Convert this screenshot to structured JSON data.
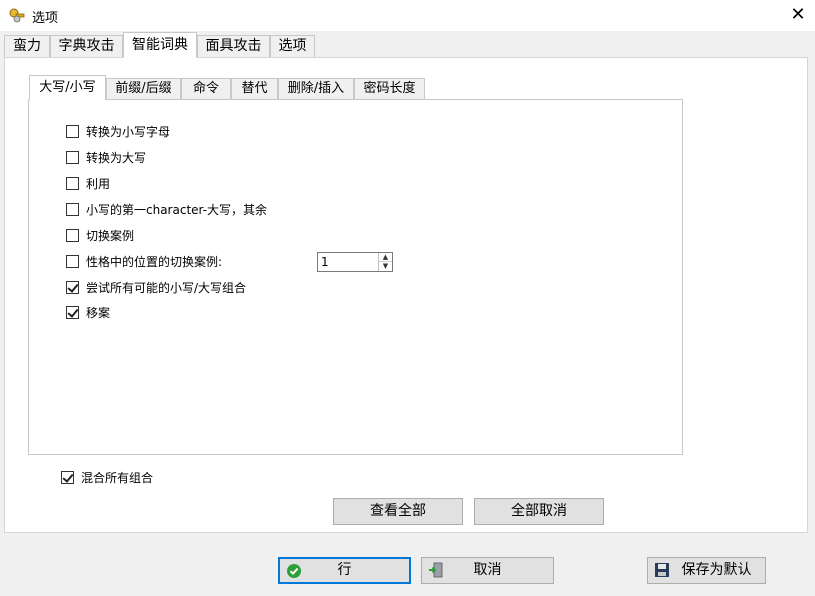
{
  "window": {
    "title": "选项"
  },
  "main_tabs": [
    {
      "label": "蛮力"
    },
    {
      "label": "字典攻击"
    },
    {
      "label": "智能词典"
    },
    {
      "label": "面具攻击"
    },
    {
      "label": "选项"
    }
  ],
  "sub_tabs": [
    {
      "label": "大写/小写"
    },
    {
      "label": "前缀/后缀"
    },
    {
      "label": "命令"
    },
    {
      "label": "替代"
    },
    {
      "label": "删除/插入"
    },
    {
      "label": "密码长度"
    }
  ],
  "checkboxes": [
    {
      "label": "转换为小写字母",
      "checked": false
    },
    {
      "label": "转换为大写",
      "checked": false
    },
    {
      "label": "利用",
      "checked": false
    },
    {
      "label": "小写的第一character-大写，其余",
      "checked": false
    },
    {
      "label": "切换案例",
      "checked": false
    },
    {
      "label": "性格中的位置的切换案例:",
      "checked": false
    },
    {
      "label": "尝试所有可能的小写/大写组合",
      "checked": true
    },
    {
      "label": "移案",
      "checked": true
    }
  ],
  "position_spinner": {
    "value": "1"
  },
  "combine_all": {
    "label": "混合所有组合",
    "checked": true
  },
  "panel_buttons": {
    "view_all": "查看全部",
    "cancel_all": "全部取消"
  },
  "footer_buttons": {
    "ok": "行",
    "cancel": "取消",
    "save_default": "保存为默认"
  },
  "colors": {
    "ok_border": "#0078d7",
    "ok_icon": "#2e9e3a"
  }
}
